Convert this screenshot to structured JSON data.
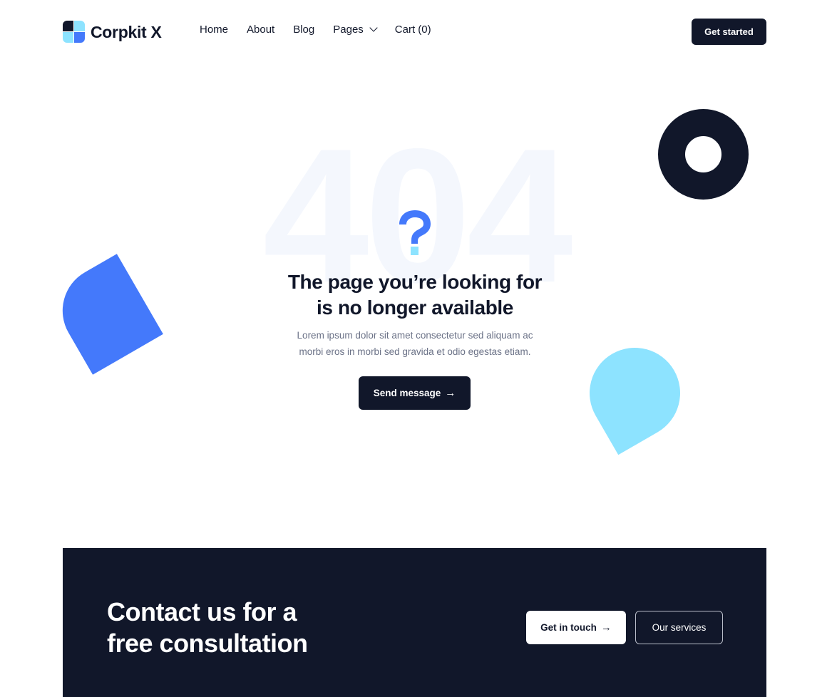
{
  "header": {
    "logo_text": "Corpkit X",
    "nav": [
      {
        "label": "Home"
      },
      {
        "label": "About"
      },
      {
        "label": "Blog"
      },
      {
        "label": "Pages",
        "has_dropdown": true
      },
      {
        "label": "Cart (0)"
      }
    ],
    "cta_label": "Get started"
  },
  "hero": {
    "error_code": "404",
    "icon": "question-mark-icon",
    "headline_line1": "The page you’re looking for",
    "headline_line2": "is no longer available",
    "description_line1": "Lorem ipsum dolor sit amet consectetur sed aliquam ac",
    "description_line2": "morbi eros in morbi sed gravida et odio egestas etiam.",
    "button_label": "Send message",
    "button_icon": "→"
  },
  "cta_band": {
    "title_line1": "Contact us for a",
    "title_line2": "free consultation",
    "primary_label": "Get in touch",
    "primary_icon": "→",
    "secondary_label": "Our services"
  },
  "colors": {
    "dark": "#11172a",
    "blue": "#4479fb",
    "cyan": "#8de3ff",
    "ghost": "#f4f7fd",
    "muted_text": "#6b7287"
  }
}
